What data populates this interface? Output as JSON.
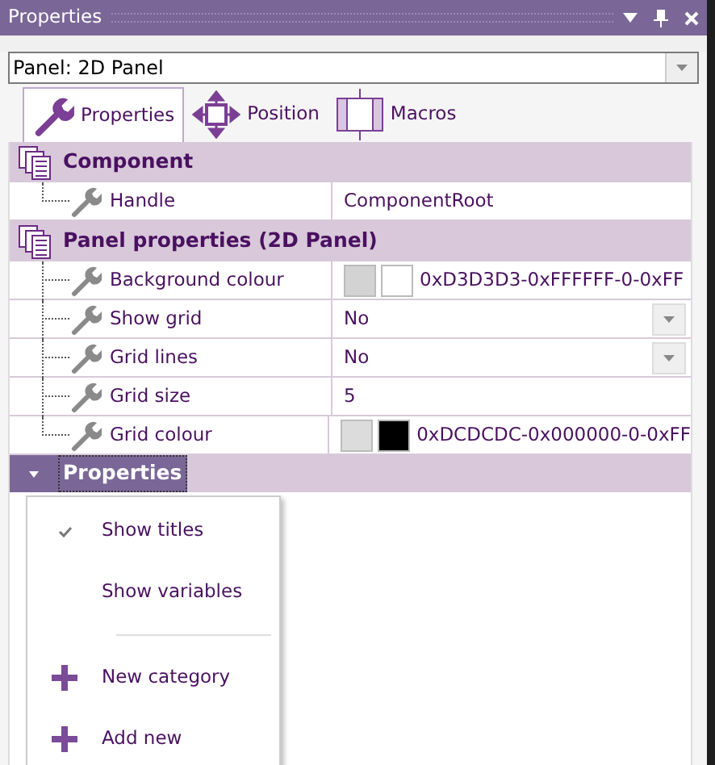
{
  "window": {
    "title": "Properties"
  },
  "selector": {
    "value": "Panel: 2D Panel"
  },
  "tabs": [
    {
      "label": "Properties",
      "selected": true,
      "kind": "wrench"
    },
    {
      "label": "Position",
      "selected": false,
      "kind": "position"
    },
    {
      "label": "Macros",
      "selected": false,
      "kind": "macros"
    }
  ],
  "groups": [
    {
      "title": "Component",
      "rows": [
        {
          "name": "Handle",
          "kind": "text",
          "value": "ComponentRoot"
        }
      ]
    },
    {
      "title": "Panel properties (2D Panel)",
      "rows": [
        {
          "name": "Background colour",
          "kind": "colour",
          "swatches": [
            {
              "color": "#d3d3d3"
            },
            {
              "color": "#ffffff"
            }
          ],
          "value": "0xD3D3D3-0xFFFFFF-0-0xFF"
        },
        {
          "name": "Show grid",
          "kind": "dropdown",
          "value": "No"
        },
        {
          "name": "Grid lines",
          "kind": "dropdown",
          "value": "No"
        },
        {
          "name": "Grid size",
          "kind": "text",
          "value": "5"
        },
        {
          "name": "Grid colour",
          "kind": "colour",
          "swatches": [
            {
              "color": "#dcdcdc"
            },
            {
              "color": "#000000"
            }
          ],
          "value": "0xDCDCDC-0x000000-0-0xFF"
        }
      ]
    }
  ],
  "category": {
    "title": "Properties",
    "expanded": true
  },
  "context_menu": [
    {
      "kind": "check",
      "label": "Show titles",
      "checked": true
    },
    {
      "kind": "check",
      "label": "Show variables",
      "checked": false
    },
    {
      "kind": "separator"
    },
    {
      "kind": "action",
      "label": "New category"
    },
    {
      "kind": "action",
      "label": "Add new"
    }
  ]
}
